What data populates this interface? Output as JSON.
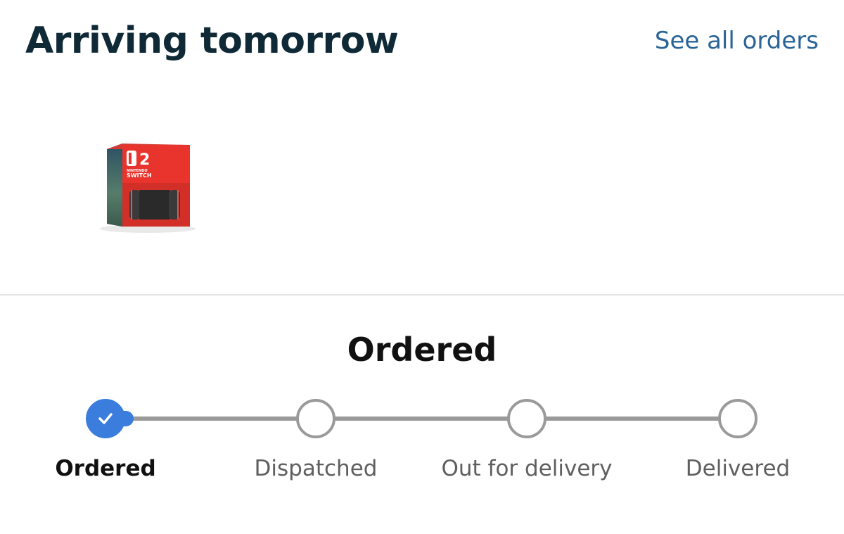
{
  "header": {
    "title": "Arriving tomorrow",
    "see_all_label": "See all orders"
  },
  "product": {
    "image_label": "Nintendo Switch 2 box",
    "box_text_brand": "NINTENDO",
    "box_text_product": "SWITCH",
    "box_text_number": "2"
  },
  "status": {
    "heading": "Ordered",
    "steps": [
      {
        "label": "Ordered",
        "state": "complete"
      },
      {
        "label": "Dispatched",
        "state": "pending"
      },
      {
        "label": "Out for delivery",
        "state": "pending"
      },
      {
        "label": "Delivered",
        "state": "pending"
      }
    ],
    "progress_fraction": 0.05
  },
  "colors": {
    "title": "#0f2a36",
    "link": "#2a6496",
    "accent": "#3b7ddd",
    "track": "#9a9a9a",
    "divider": "#e3e3e3"
  },
  "icons": {
    "check": "check-icon"
  }
}
